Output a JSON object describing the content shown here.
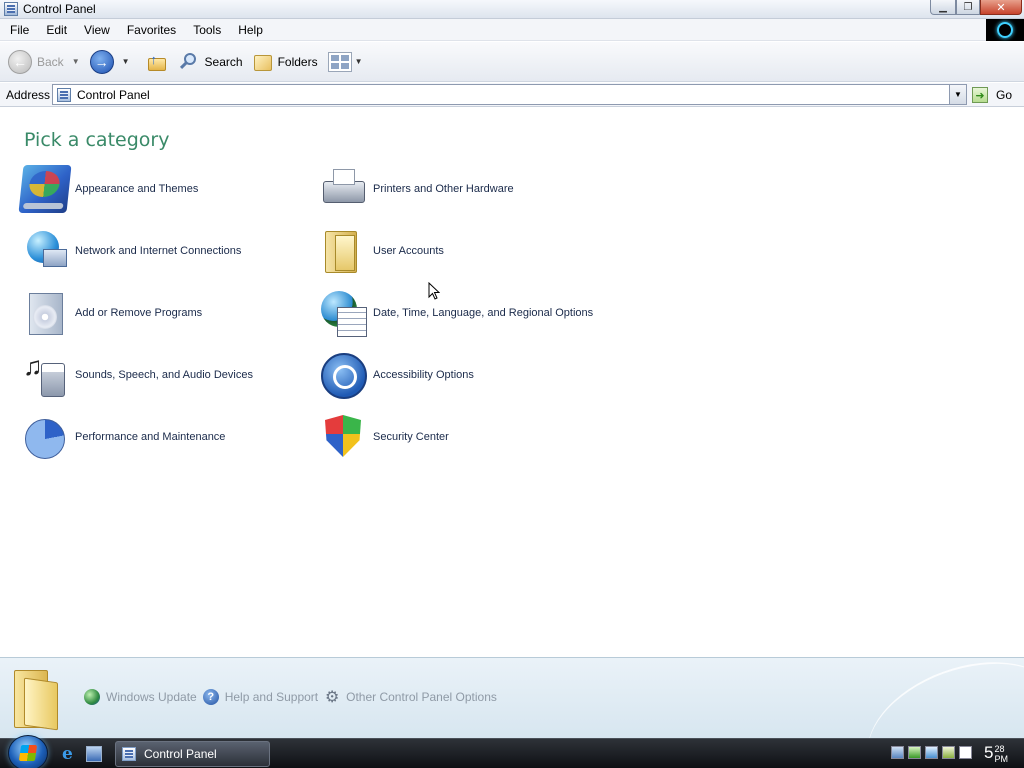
{
  "window": {
    "title": "Control Panel"
  },
  "menubar": {
    "items": [
      "File",
      "Edit",
      "View",
      "Favorites",
      "Tools",
      "Help"
    ]
  },
  "toolbar": {
    "back_label": "Back",
    "search_label": "Search",
    "folders_label": "Folders"
  },
  "address": {
    "label": "Address",
    "value": "Control Panel",
    "go_label": "Go"
  },
  "main": {
    "heading": "Pick a category",
    "categories_left": [
      {
        "label": "Appearance and Themes",
        "icon": "appearance-icon"
      },
      {
        "label": "Network and Internet Connections",
        "icon": "network-icon"
      },
      {
        "label": "Add or Remove Programs",
        "icon": "add-remove-programs-icon"
      },
      {
        "label": "Sounds, Speech, and Audio Devices",
        "icon": "sounds-icon"
      },
      {
        "label": "Performance and Maintenance",
        "icon": "performance-icon"
      }
    ],
    "categories_right": [
      {
        "label": "Printers and Other Hardware",
        "icon": "printer-icon"
      },
      {
        "label": "User Accounts",
        "icon": "user-accounts-icon"
      },
      {
        "label": "Date, Time, Language, and Regional Options",
        "icon": "date-time-icon"
      },
      {
        "label": "Accessibility Options",
        "icon": "accessibility-icon"
      },
      {
        "label": "Security Center",
        "icon": "security-shield-icon"
      }
    ]
  },
  "bottom_links": [
    {
      "label": "Windows Update",
      "icon": "windows-update-icon"
    },
    {
      "label": "Help and Support",
      "icon": "help-icon"
    },
    {
      "label": "Other Control Panel Options",
      "icon": "gear-icon"
    }
  ],
  "taskbar": {
    "task_label": "Control Panel",
    "clock": {
      "hour": "5",
      "minute": "28",
      "ampm": "PM"
    }
  }
}
